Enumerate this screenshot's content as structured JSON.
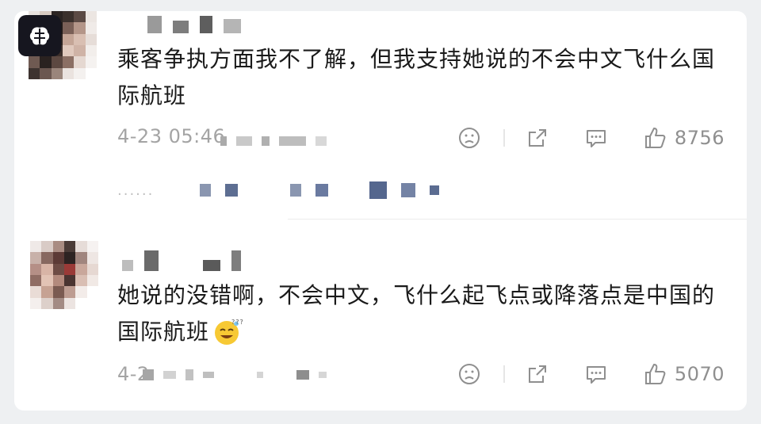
{
  "comments": [
    {
      "text": "乘客争执方面我不了解，但我支持她说的不会中文飞什么国际航班",
      "timestamp": "4-23 05:46",
      "likes": "8756"
    },
    {
      "text": "她说的没错啊，不会中文，飞什么起飞点或降落点是中国的国际航班",
      "timestamp": "4-2",
      "likes": "5070",
      "emoji": "sweat-smile-emoji"
    }
  ],
  "colors": {
    "background": "#eef0f2",
    "card": "#ffffff",
    "text": "#1a1a1a",
    "meta": "#a4a4a4",
    "icon": "#8f8f8f"
  },
  "icons": [
    "brain-icon",
    "dislike-icon",
    "share-icon",
    "comment-icon",
    "like-icon"
  ]
}
